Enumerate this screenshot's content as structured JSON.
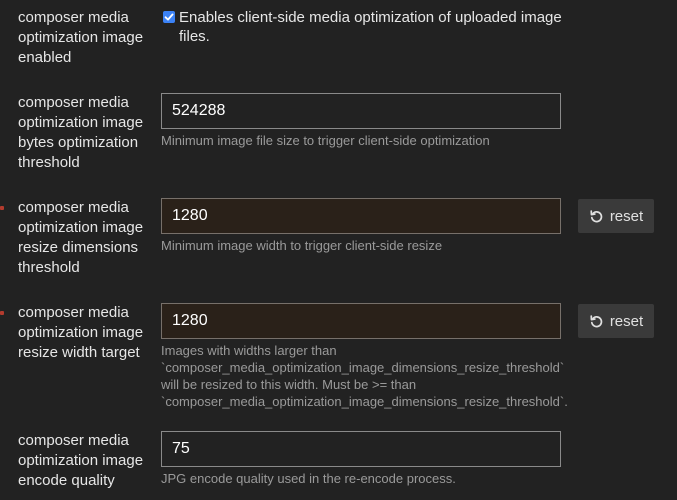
{
  "settings": {
    "image_enabled": {
      "label": "composer media optimization image enabled",
      "checked": true,
      "checkbox_label": "Enables client-side media optimization of uploaded image files."
    },
    "bytes_threshold": {
      "label": "composer media optimization image bytes optimization threshold",
      "value": "524288",
      "description": "Minimum image file size to trigger client-side optimization"
    },
    "resize_dimensions": {
      "label": "composer media optimization image resize dimensions threshold",
      "value": "1280",
      "description": "Minimum image width to trigger client-side resize",
      "reset_label": "reset"
    },
    "resize_width": {
      "label": "composer media optimization image resize width target",
      "value": "1280",
      "description": "Images with widths larger than `composer_media_optimization_image_dimensions_resize_threshold` will be resized to this width. Must be >= than `composer_media_optimization_image_dimensions_resize_threshold`.",
      "reset_label": "reset"
    },
    "encode_quality": {
      "label": "composer media optimization image encode quality",
      "value": "75",
      "description": "JPG encode quality used in the re-encode process."
    }
  },
  "icons": {
    "checkbox": "checkmark-icon",
    "reset": "undo-icon"
  },
  "colors": {
    "background": "#222222",
    "checkbox_accent": "#3b82f6",
    "changed_marker": "#b33b2e",
    "overridden_input_bg": "#2a2119"
  }
}
